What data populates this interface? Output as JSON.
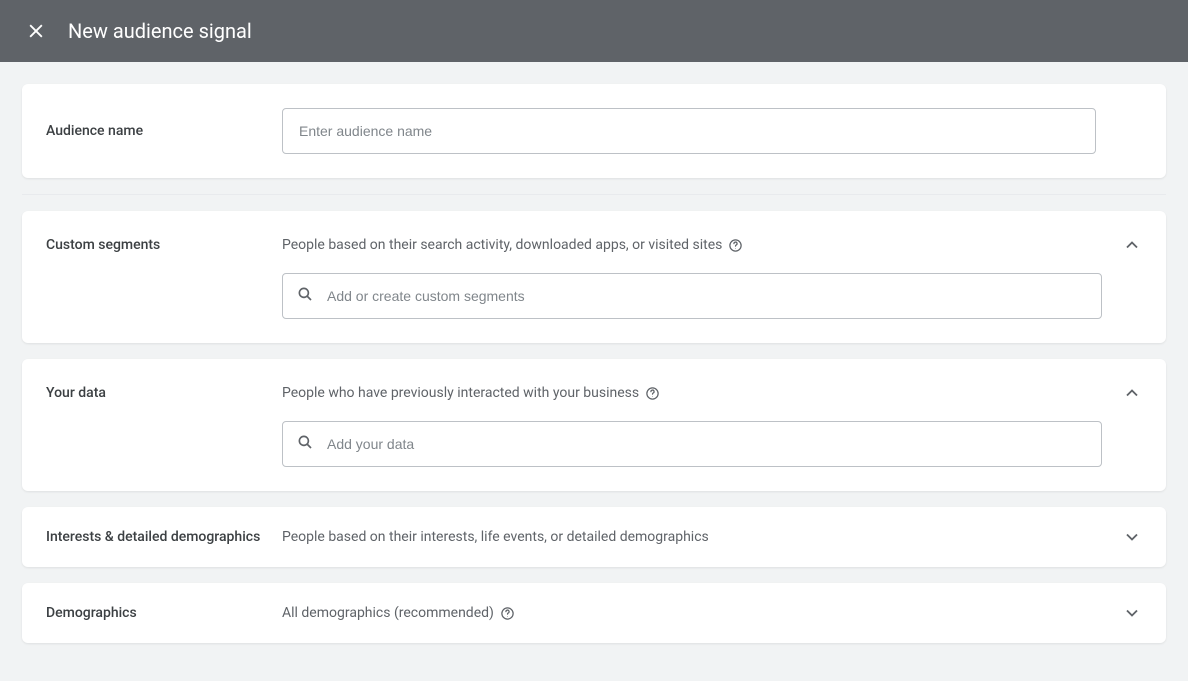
{
  "header": {
    "title": "New audience signal"
  },
  "sections": {
    "audienceName": {
      "label": "Audience name",
      "placeholder": "Enter audience name"
    },
    "customSegments": {
      "label": "Custom segments",
      "description": "People based on their search activity, downloaded apps, or visited sites",
      "placeholder": "Add or create custom segments"
    },
    "yourData": {
      "label": "Your data",
      "description": "People who have previously interacted with your business",
      "placeholder": "Add your data"
    },
    "interests": {
      "label": "Interests & detailed demographics",
      "description": "People based on their interests, life events, or detailed demographics"
    },
    "demographics": {
      "label": "Demographics",
      "description": "All demographics (recommended)"
    }
  }
}
